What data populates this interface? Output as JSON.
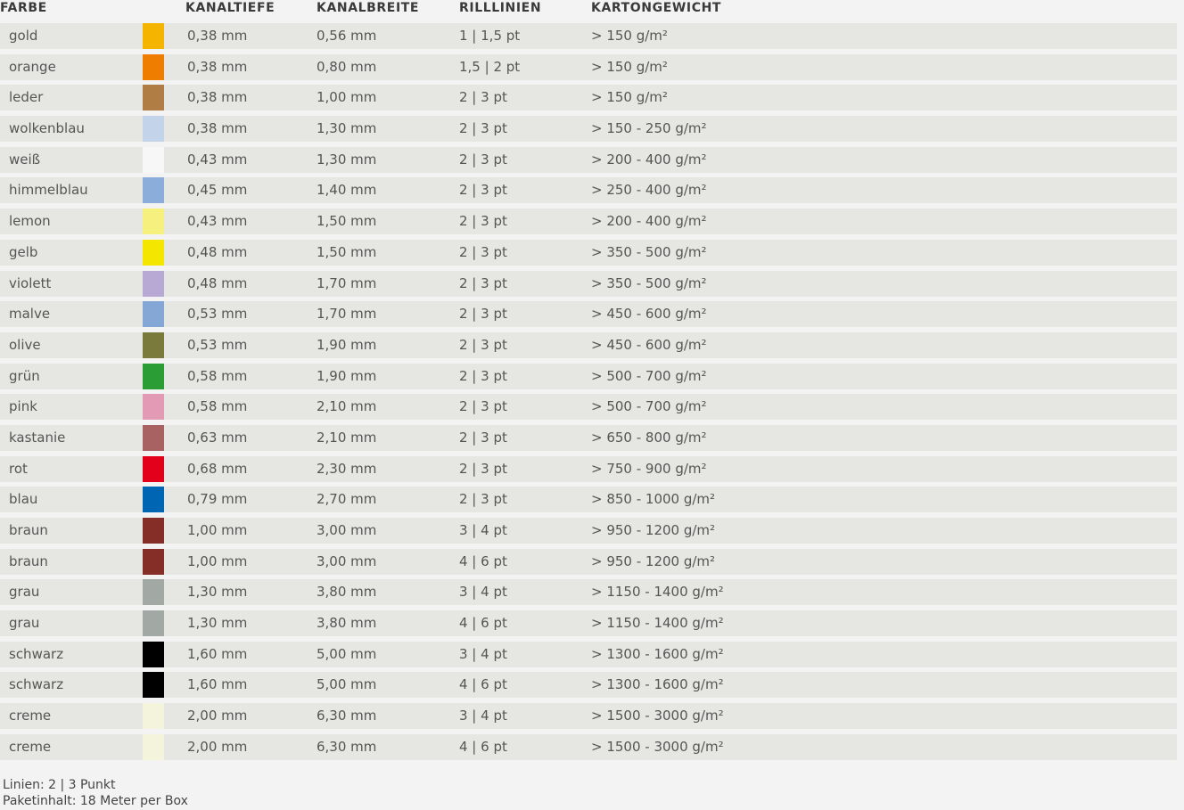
{
  "table": {
    "headers": {
      "farbe": "FARBE",
      "kanaltiefe": "KANALTIEFE",
      "kanalbreite": "KANALBREITE",
      "rilllinien": "RILLLINIEN",
      "kartongewicht": "KARTONGEWICHT"
    },
    "rows": [
      {
        "name": "gold",
        "color": "#f5b400",
        "tiefe": "0,38 mm",
        "breite": "0,56 mm",
        "rill": "1 | 1,5 pt",
        "gewicht": "> 150 g/m²"
      },
      {
        "name": "orange",
        "color": "#ef7d00",
        "tiefe": "0,38 mm",
        "breite": "0,80 mm",
        "rill": "1,5 | 2 pt",
        "gewicht": "> 150 g/m²"
      },
      {
        "name": "leder",
        "color": "#b07d45",
        "tiefe": "0,38 mm",
        "breite": "1,00 mm",
        "rill": "2 | 3 pt",
        "gewicht": "> 150 g/m²"
      },
      {
        "name": "wolkenblau",
        "color": "#c2d3ea",
        "tiefe": "0,38 mm",
        "breite": "1,30 mm",
        "rill": "2 | 3 pt",
        "gewicht": "> 150 - 250 g/m²"
      },
      {
        "name": "weiß",
        "color": "#f7f7f7",
        "tiefe": "0,43 mm",
        "breite": "1,30 mm",
        "rill": "2 | 3 pt",
        "gewicht": "> 200 - 400 g/m²"
      },
      {
        "name": "himmelblau",
        "color": "#8aaed9",
        "tiefe": "0,45 mm",
        "breite": "1,40 mm",
        "rill": "2 | 3 pt",
        "gewicht": "> 250 - 400 g/m²"
      },
      {
        "name": "lemon",
        "color": "#f6f17e",
        "tiefe": "0,43 mm",
        "breite": "1,50 mm",
        "rill": "2 | 3 pt",
        "gewicht": "> 200 - 400 g/m²"
      },
      {
        "name": "gelb",
        "color": "#f5e600",
        "tiefe": "0,48 mm",
        "breite": "1,50 mm",
        "rill": "2 | 3 pt",
        "gewicht": "> 350 - 500 g/m²"
      },
      {
        "name": "violett",
        "color": "#b8a8d4",
        "tiefe": "0,48 mm",
        "breite": "1,70 mm",
        "rill": "2 | 3 pt",
        "gewicht": "> 350 - 500 g/m²"
      },
      {
        "name": "malve",
        "color": "#85a7d6",
        "tiefe": "0,53 mm",
        "breite": "1,70 mm",
        "rill": "2 | 3 pt",
        "gewicht": "> 450 - 600 g/m²"
      },
      {
        "name": "olive",
        "color": "#7a7a3c",
        "tiefe": "0,53 mm",
        "breite": "1,90 mm",
        "rill": "2 | 3 pt",
        "gewicht": "> 450 - 600 g/m²"
      },
      {
        "name": "grün",
        "color": "#2a9e35",
        "tiefe": "0,58 mm",
        "breite": "1,90 mm",
        "rill": "2 | 3 pt",
        "gewicht": "> 500 - 700 g/m²"
      },
      {
        "name": "pink",
        "color": "#e39ab5",
        "tiefe": "0,58 mm",
        "breite": "2,10 mm",
        "rill": "2 | 3 pt",
        "gewicht": "> 500 - 700 g/m²"
      },
      {
        "name": "kastanie",
        "color": "#a86262",
        "tiefe": "0,63 mm",
        "breite": "2,10 mm",
        "rill": "2 | 3 pt",
        "gewicht": "> 650 - 800 g/m²"
      },
      {
        "name": "rot",
        "color": "#e3001b",
        "tiefe": "0,68 mm",
        "breite": "2,30 mm",
        "rill": "2 | 3 pt",
        "gewicht": "> 750 - 900 g/m²"
      },
      {
        "name": "blau",
        "color": "#0066b3",
        "tiefe": "0,79 mm",
        "breite": "2,70 mm",
        "rill": "2 | 3 pt",
        "gewicht": "> 850 - 1000 g/m²"
      },
      {
        "name": "braun",
        "color": "#842e27",
        "tiefe": "1,00 mm",
        "breite": "3,00 mm",
        "rill": "3 | 4 pt",
        "gewicht": "> 950 - 1200 g/m²"
      },
      {
        "name": "braun",
        "color": "#842e27",
        "tiefe": "1,00 mm",
        "breite": "3,00 mm",
        "rill": "4 | 6 pt",
        "gewicht": "> 950 - 1200 g/m²"
      },
      {
        "name": "grau",
        "color": "#a2a8a4",
        "tiefe": "1,30 mm",
        "breite": "3,80 mm",
        "rill": "3 | 4 pt",
        "gewicht": "> 1150 - 1400 g/m²"
      },
      {
        "name": "grau",
        "color": "#a2a8a4",
        "tiefe": "1,30 mm",
        "breite": "3,80 mm",
        "rill": "4 | 6 pt",
        "gewicht": "> 1150 - 1400 g/m²"
      },
      {
        "name": "schwarz",
        "color": "#000000",
        "tiefe": "1,60 mm",
        "breite": "5,00 mm",
        "rill": "3 | 4 pt",
        "gewicht": "> 1300 - 1600 g/m²"
      },
      {
        "name": "schwarz",
        "color": "#000000",
        "tiefe": "1,60 mm",
        "breite": "5,00 mm",
        "rill": "4 | 6 pt",
        "gewicht": "> 1300 - 1600 g/m²"
      },
      {
        "name": "creme",
        "color": "#f4f3dc",
        "tiefe": "2,00 mm",
        "breite": "6,30 mm",
        "rill": "3 | 4 pt",
        "gewicht": "> 1500 - 3000 g/m²"
      },
      {
        "name": "creme",
        "color": "#f4f3dc",
        "tiefe": "2,00 mm",
        "breite": "6,30 mm",
        "rill": "4 | 6 pt",
        "gewicht": "> 1500 - 3000 g/m²"
      }
    ]
  },
  "footer": {
    "linien": "Linien: 2 | 3 Punkt",
    "paketinhalt": "Paketinhalt: 18 Meter per Box"
  }
}
